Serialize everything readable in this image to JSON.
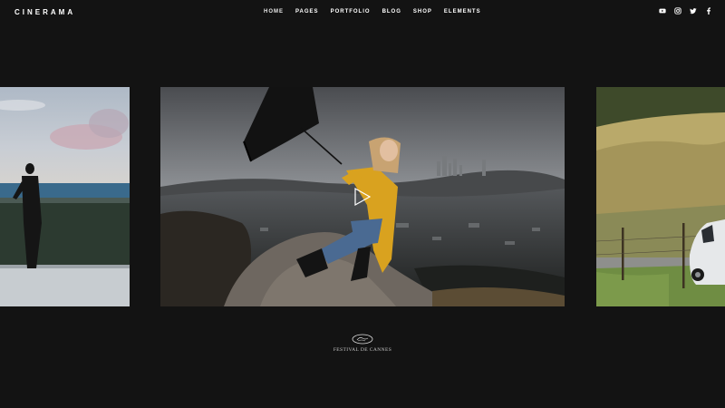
{
  "header": {
    "logo": "CINERAMA",
    "nav": [
      {
        "label": "HOME"
      },
      {
        "label": "PAGES"
      },
      {
        "label": "PORTFOLIO"
      },
      {
        "label": "BLOG"
      },
      {
        "label": "SHOP"
      },
      {
        "label": "ELEMENTS"
      }
    ],
    "social": [
      {
        "icon": "youtube-icon"
      },
      {
        "icon": "instagram-icon"
      },
      {
        "icon": "twitter-icon"
      },
      {
        "icon": "facebook-icon"
      }
    ]
  },
  "slides": [
    {
      "scene": "silhouette-by-sea"
    },
    {
      "scene": "woman-with-umbrella-on-rock"
    },
    {
      "scene": "grass-field-white-car"
    }
  ],
  "caption": {
    "label": "FESTIVAL DE CANNES"
  },
  "colors": {
    "background": "#131313",
    "accent_yellow": "#d9a21f"
  }
}
